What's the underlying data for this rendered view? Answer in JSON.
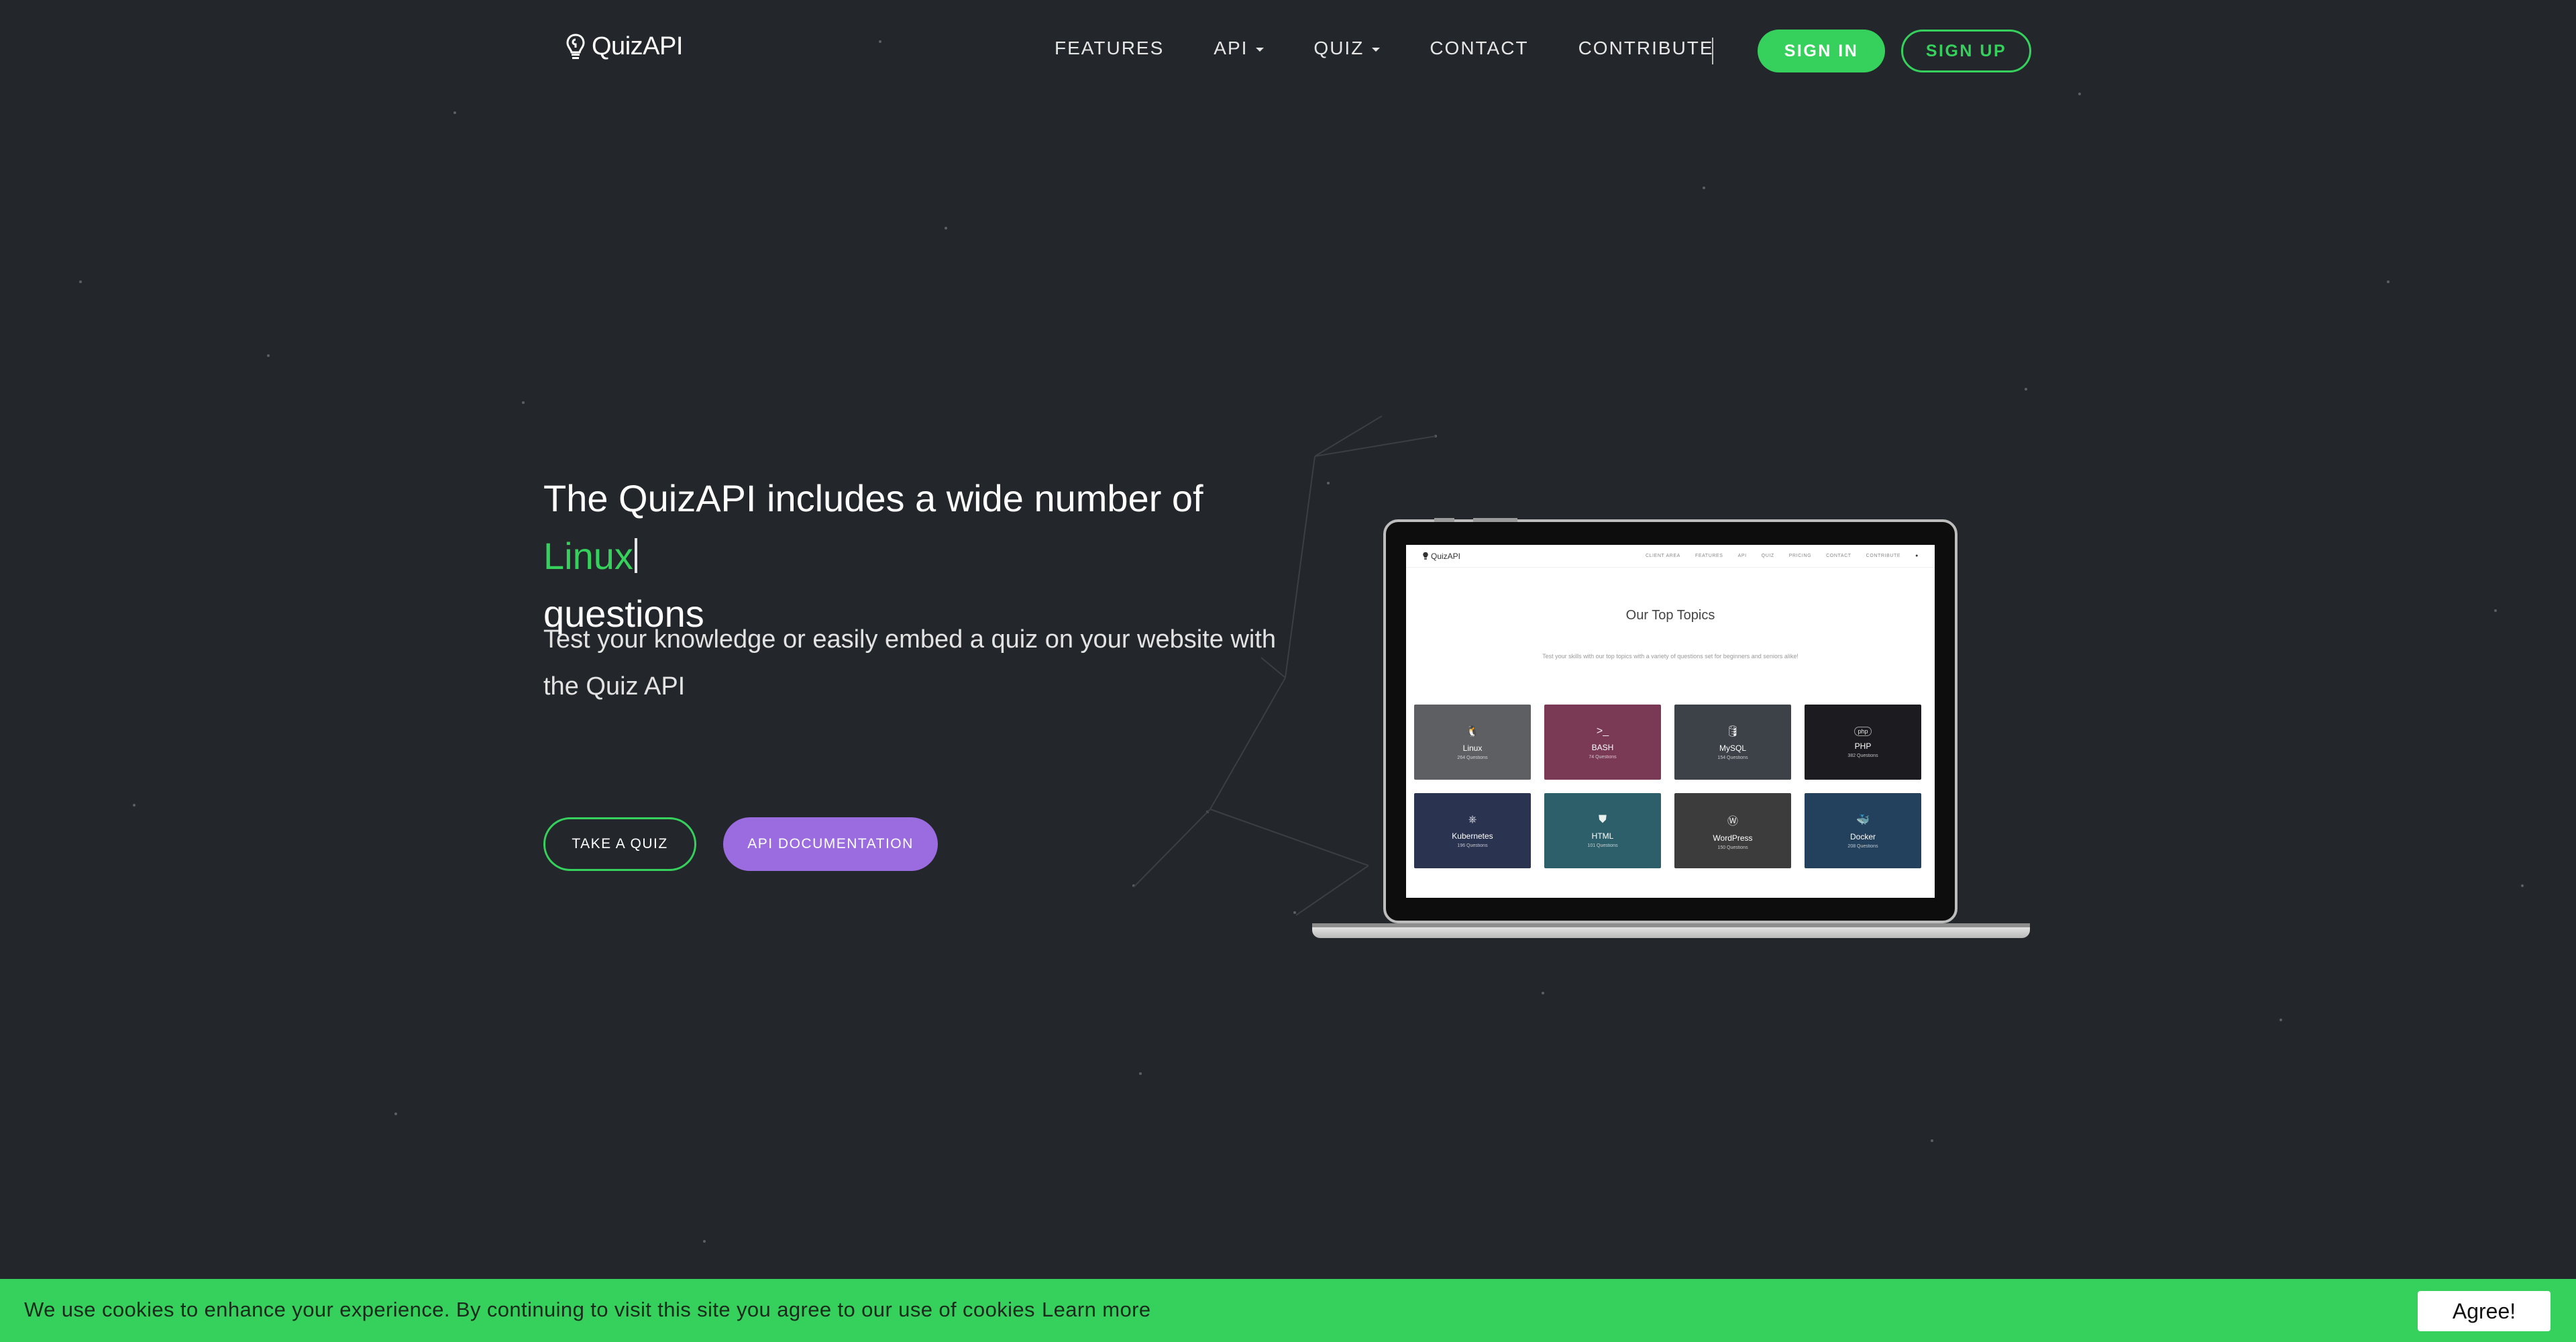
{
  "nav": {
    "logo_text": "QuizAPI",
    "items": [
      {
        "label": "FEATURES",
        "dropdown": false
      },
      {
        "label": "API",
        "dropdown": true
      },
      {
        "label": "QUIZ",
        "dropdown": true
      },
      {
        "label": "CONTACT",
        "dropdown": false
      },
      {
        "label": "CONTRIBUTE",
        "dropdown": false
      }
    ],
    "sign_in": "SIGN IN",
    "sign_up": "SIGN UP"
  },
  "hero": {
    "title_prefix": "The QuizAPI includes a wide number of ",
    "title_highlight": "Linux",
    "title_suffix": "questions",
    "subtitle": "Test your knowledge or easily embed a quiz on your website with the Quiz API",
    "primary_button": "TAKE A QUIZ",
    "secondary_button": "API DOCUMENTATION"
  },
  "laptop_screen": {
    "logo_text": "QuizAPI",
    "menu": [
      "CLIENT AREA",
      "FEATURES",
      "API",
      "QUIZ",
      "PRICING",
      "CONTACT",
      "CONTRIBUTE"
    ],
    "title": "Our Top Topics",
    "subtitle": "Test your skills with our top topics with a variety of questions set for beginners and seniors alike!",
    "topics": [
      {
        "name": "Linux",
        "count": "264 Questions",
        "icon": "linux-icon",
        "color": "#5e5f63"
      },
      {
        "name": "BASH",
        "count": "74 Questions",
        "icon": "terminal-icon",
        "color": "#7a3a55"
      },
      {
        "name": "MySQL",
        "count": "154 Questions",
        "icon": "database-icon",
        "color": "#3d4148"
      },
      {
        "name": "PHP",
        "count": "382 Questions",
        "icon": "php-icon",
        "color": "#1c1c20"
      },
      {
        "name": "Kubernetes",
        "count": "196 Questions",
        "icon": "kubernetes-icon",
        "color": "#2a3350"
      },
      {
        "name": "HTML",
        "count": "101 Questions",
        "icon": "html5-icon",
        "color": "#2c5f6a"
      },
      {
        "name": "WordPress",
        "count": "150 Questions",
        "icon": "wordpress-icon",
        "color": "#3c3c3c"
      },
      {
        "name": "Docker",
        "count": "208 Questions",
        "icon": "docker-icon",
        "color": "#23405c"
      }
    ]
  },
  "cookie": {
    "text": "We use cookies to enhance your experience. By continuing to visit this site you agree to our use of cookies",
    "link": "Learn more",
    "button": "Agree!"
  },
  "colors": {
    "background": "#23272b",
    "accent_green": "#36d15c",
    "accent_purple": "#9b6be0"
  }
}
